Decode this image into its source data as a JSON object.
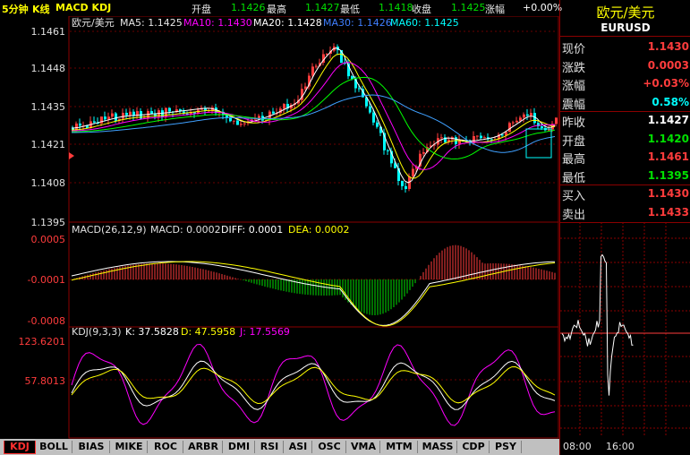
{
  "header": {
    "period": "5分钟",
    "chart_kind": "K线",
    "indicators": "MACD KDJ",
    "open_label": "开盘",
    "open_value": "1.1426",
    "high_label": "最高",
    "high_value": "1.1427",
    "low_label": "最低",
    "low_value": "1.1418",
    "close_label": "收盘",
    "close_value": "1.1425",
    "change_label": "涨幅",
    "change_value": "+0.00%"
  },
  "main_chart": {
    "symbol_name": "欧元/美元",
    "ma5": "MA5: 1.1425",
    "ma10": "MA10: 1.1430",
    "ma20": "MA20: 1.1428",
    "ma30": "MA30: 1.1426",
    "ma60": "MA60: 1.1425",
    "y_ticks": [
      "1.1461",
      "1.1448",
      "1.1435",
      "1.1421",
      "1.1408",
      "1.1395"
    ],
    "colors": {
      "ma5": "#ffffff",
      "ma10": "#ffff00",
      "ma20": "#ff00ff",
      "ma30": "#00ff00",
      "ma60": "#3fa0ff",
      "up": "#ff3c3c",
      "down": "#00ffff"
    }
  },
  "macd": {
    "title": "MACD(26,12,9)",
    "macd_value": "MACD: 0.0002",
    "diff": "DIFF: 0.0001",
    "dea": "DEA: 0.0002",
    "y_ticks": [
      "0.0005",
      "-0.0001",
      "-0.0008"
    ]
  },
  "kdj": {
    "title": "KDJ(9,3,3)",
    "k": "K: 37.5828",
    "d": "D: 47.5958",
    "j": "J: 17.5569",
    "y_ticks": [
      "123.6201",
      "57.8013"
    ]
  },
  "quote": {
    "name": "欧元/美元",
    "code": "EURUSD",
    "rows": [
      {
        "label": "现价",
        "value": "1.1430",
        "color": "#ff3c3c"
      },
      {
        "label": "涨跌",
        "value": "0.0003",
        "color": "#ff3c3c"
      },
      {
        "label": "涨幅",
        "value": "+0.03%",
        "color": "#ff3c3c"
      },
      {
        "label": "震幅",
        "value": "0.58%",
        "color": "#00ffff"
      },
      {
        "label": "昨收",
        "value": "1.1427",
        "color": "#ffffff"
      },
      {
        "label": "开盘",
        "value": "1.1420",
        "color": "#00e000"
      },
      {
        "label": "最高",
        "value": "1.1461",
        "color": "#ff3c3c"
      },
      {
        "label": "最低",
        "value": "1.1395",
        "color": "#00e000"
      },
      {
        "label": "买入",
        "value": "1.1430",
        "color": "#ff3c3c"
      },
      {
        "label": "卖出",
        "value": "1.1433",
        "color": "#ff3c3c"
      }
    ],
    "time_ticks": [
      "08:00",
      "16:00"
    ]
  },
  "tabs": [
    "KDJ",
    "BOLL",
    "BIAS",
    "MIKE",
    "ROC",
    "ARBR",
    "DMI",
    "RSI",
    "ASI",
    "OSC",
    "VMA",
    "MTM",
    "MASS",
    "CDP",
    "PSY"
  ],
  "active_tab": "KDJ"
}
